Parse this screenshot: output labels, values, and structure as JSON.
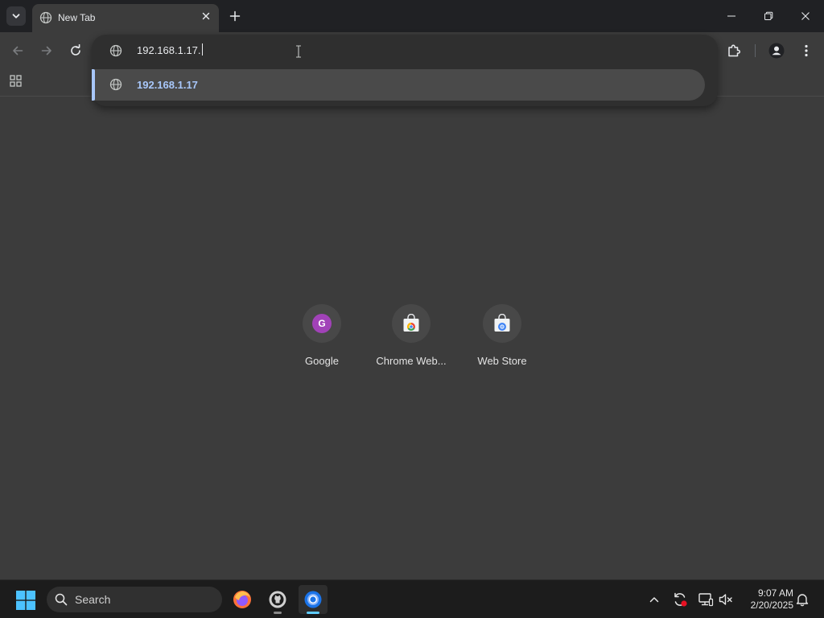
{
  "browser": {
    "tab": {
      "title": "New Tab"
    },
    "omnibox": {
      "input_value": "192.168.1.17.",
      "suggestions": [
        {
          "text": "192.168.1.17"
        }
      ]
    }
  },
  "shortcuts": [
    {
      "label": "Google",
      "badge": "G",
      "icon": "google-letter-icon"
    },
    {
      "label": "Chrome Web...",
      "icon": "chrome-web-store-icon"
    },
    {
      "label": "Web Store",
      "icon": "web-store-icon"
    }
  ],
  "taskbar": {
    "search_label": "Search",
    "apps": [
      "firefox-icon",
      "github-desktop-icon",
      "chrome-icon"
    ],
    "clock": {
      "time": "9:07 AM",
      "date": "2/20/2025"
    }
  },
  "colors": {
    "accent": "#a8c7fa",
    "page_bg": "#3c3c3c",
    "frame_bg": "#202124",
    "taskbar_bg": "#1c1c1c",
    "google_badge": "#a142b8"
  }
}
